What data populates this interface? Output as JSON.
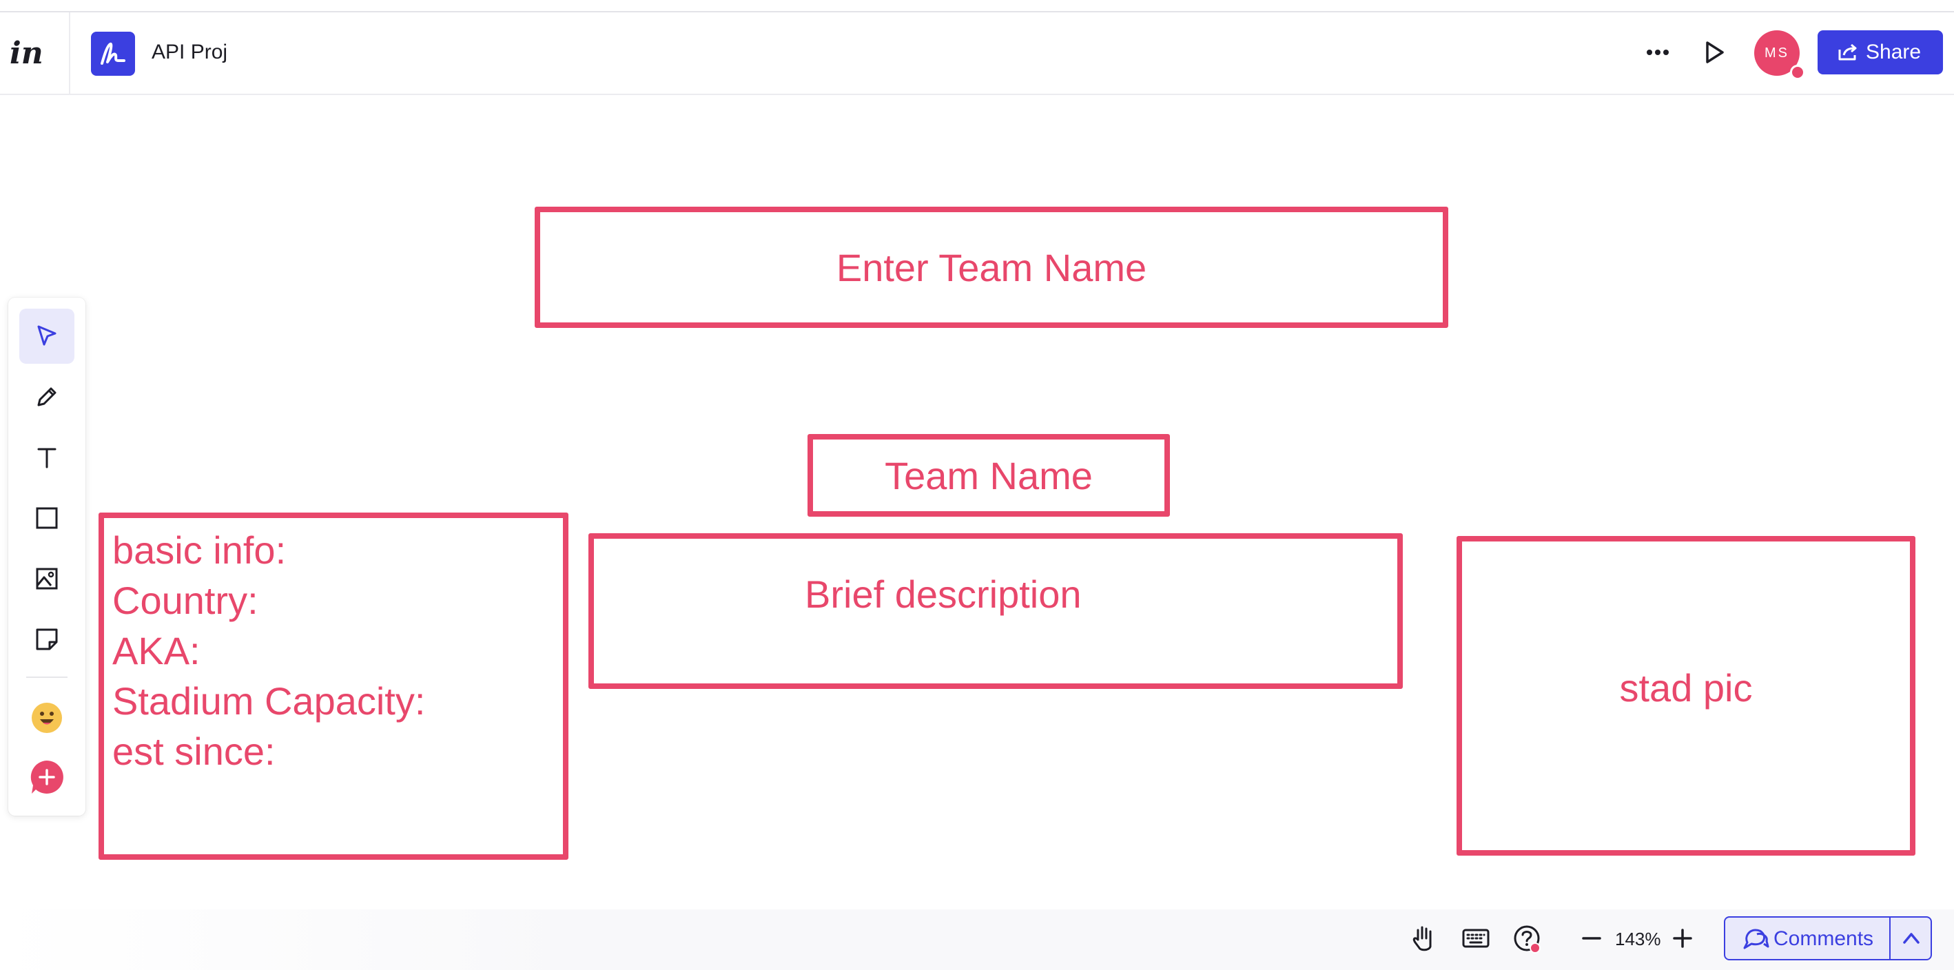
{
  "header": {
    "logo_text": "in",
    "project_name": "API Proj",
    "avatar_initials": "MS",
    "share_label": "Share"
  },
  "toolbar": {
    "tools": [
      "select",
      "pencil",
      "text",
      "rectangle",
      "image",
      "sticky-note",
      "emoji",
      "add"
    ]
  },
  "canvas": {
    "shapes": {
      "enter_team_name": "Enter Team Name",
      "team_name": "Team Name",
      "brief_description": "Brief description",
      "stad_pic": "stad pic",
      "basic_info_lines": [
        "basic info:",
        "Country:",
        "AKA:",
        "Stadium Capacity:",
        "est since:"
      ]
    }
  },
  "bottom": {
    "zoom": "143%",
    "comments_label": "Comments"
  },
  "colors": {
    "accent": "#3b3fe0",
    "shape": "#e8476b",
    "avatar": "#e8456b"
  }
}
